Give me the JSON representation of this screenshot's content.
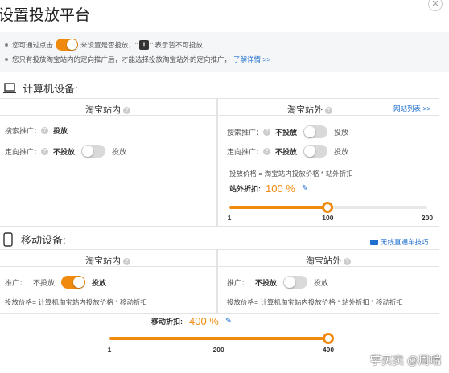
{
  "page": {
    "title": "设置投放平台"
  },
  "info": {
    "line1_prefix": "您可通过点击",
    "line1_middle": "来设置是否投放，\"",
    "line1_warn": "!",
    "line1_suffix": "\" 表示暂不可投放",
    "line2_text": "您只有投放淘宝站内的定向推广后，才能选择投放淘宝站外的定向推广，",
    "line2_link": "了解详情 >>"
  },
  "computer": {
    "heading": "计算机设备:",
    "inside": {
      "title": "淘宝站内",
      "search_label": "搜索推广：",
      "search_value": "投放",
      "target_label": "定向推广：",
      "target_off": "不投放",
      "target_on": "投放",
      "target_toggle": false
    },
    "outside": {
      "title": "淘宝站外",
      "site_list_link": "网站列表 >>",
      "search_label": "搜索推广：",
      "search_off": "不投放",
      "search_on": "投放",
      "search_toggle": false,
      "target_label": "定向推广：",
      "target_off": "不投放",
      "target_on": "投放",
      "target_toggle": false,
      "formula": "投放价格 = 淘宝站内投放价格 * 站外折扣",
      "discount_label": "站外折扣:",
      "discount_value": "100 %",
      "slider": {
        "min": 1,
        "max": 200,
        "value": 100,
        "ticks": [
          "1",
          "100",
          "200"
        ]
      }
    }
  },
  "mobile": {
    "heading": "移动设备:",
    "tips_link": "无线直通车技巧",
    "inside": {
      "title": "淘宝站内",
      "label": "推广：",
      "off": "不投放",
      "on": "投放",
      "toggle": true,
      "formula": "投放价格= 计算机淘宝站内投放价格 * 移动折扣"
    },
    "outside": {
      "title": "淘宝站外",
      "label": "推广：",
      "off": "不投放",
      "on": "投放",
      "toggle": false,
      "formula": "投放价格= 计算机淘宝站内投放价格 * 站外折扣 * 移动折扣"
    },
    "discount_label": "移动折扣:",
    "discount_value": "400 %",
    "slider": {
      "min": 1,
      "max": 400,
      "value": 400,
      "ticks": [
        "1",
        "200",
        "400"
      ]
    }
  },
  "watermark": "学买卖 @周瑞",
  "colors": {
    "accent": "#f08a0f",
    "link": "#1f6fd1",
    "info_bg": "#f5f6f8"
  }
}
